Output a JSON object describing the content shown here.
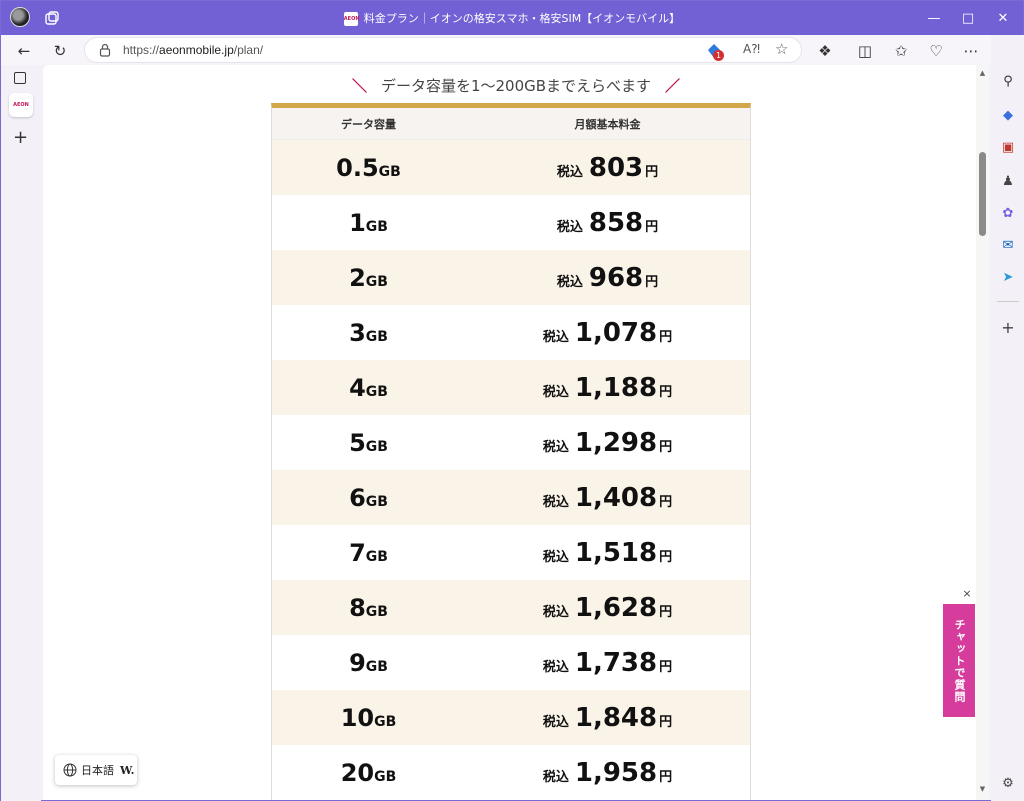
{
  "browser": {
    "tab_title": "料金プラン｜イオンの格安スマホ・格安SIM【イオンモバイル】",
    "favicon_text": "AEON",
    "url_prefix": "https://",
    "url_host": "aeonmobile.jp",
    "url_path": "/plan/",
    "notification_badge": "1",
    "icons": [
      "back-icon",
      "refresh-icon",
      "lock-icon",
      "read-aloud-icon",
      "favorite-star-icon",
      "extensions-icon",
      "split-screen-icon",
      "favorites-icon",
      "copilot-icon",
      "more-icon"
    ]
  },
  "page": {
    "heading": "データ容量を1〜200GBまでえらべます",
    "table": {
      "col_data": "データ容量",
      "col_price": "月額基本料金",
      "tax_label": "税込",
      "yen": "円",
      "gb_unit": "GB",
      "rows": [
        {
          "data": "0.5",
          "price": "803"
        },
        {
          "data": "1",
          "price": "858"
        },
        {
          "data": "2",
          "price": "968"
        },
        {
          "data": "3",
          "price": "1,078"
        },
        {
          "data": "4",
          "price": "1,188"
        },
        {
          "data": "5",
          "price": "1,298"
        },
        {
          "data": "6",
          "price": "1,408"
        },
        {
          "data": "7",
          "price": "1,518"
        },
        {
          "data": "8",
          "price": "1,628"
        },
        {
          "data": "9",
          "price": "1,738"
        },
        {
          "data": "10",
          "price": "1,848"
        },
        {
          "data": "20",
          "price": "1,958"
        }
      ]
    }
  },
  "widgets": {
    "language": "日本語",
    "language_logo": "W.",
    "chat_label": "チャットで質問",
    "chat_close": "×"
  },
  "colors": {
    "titlebar": "#7161d4",
    "table_top_border": "#d4a64a",
    "row_alt": "#faf3e8",
    "chat": "#d63c9c",
    "accent_slash": "#c2185b"
  }
}
